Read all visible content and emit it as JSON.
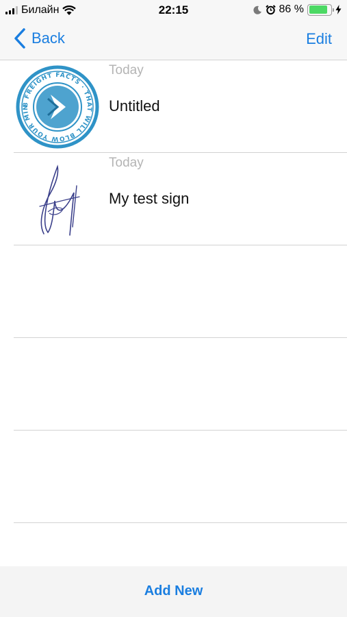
{
  "status_bar": {
    "carrier": "Билайн",
    "time": "22:15",
    "battery_percent": "86 %",
    "battery_level": 0.86,
    "icons": [
      "signal-icon",
      "wifi-icon",
      "moon-icon",
      "alarm-icon",
      "battery-icon",
      "charging-icon"
    ]
  },
  "nav": {
    "back_label": "Back",
    "edit_label": "Edit",
    "accent_color": "#1a7ee0"
  },
  "items": [
    {
      "date": "Today",
      "title": "Untitled",
      "thumbnail": "stamp-image",
      "stamp_text": "8 FREIGHT FACTS · THAT WILL BLOW YOUR MIND"
    },
    {
      "date": "Today",
      "title": "My test sign",
      "thumbnail": "signature-image"
    }
  ],
  "empty_rows": 3,
  "footer": {
    "add_new_label": "Add New"
  }
}
